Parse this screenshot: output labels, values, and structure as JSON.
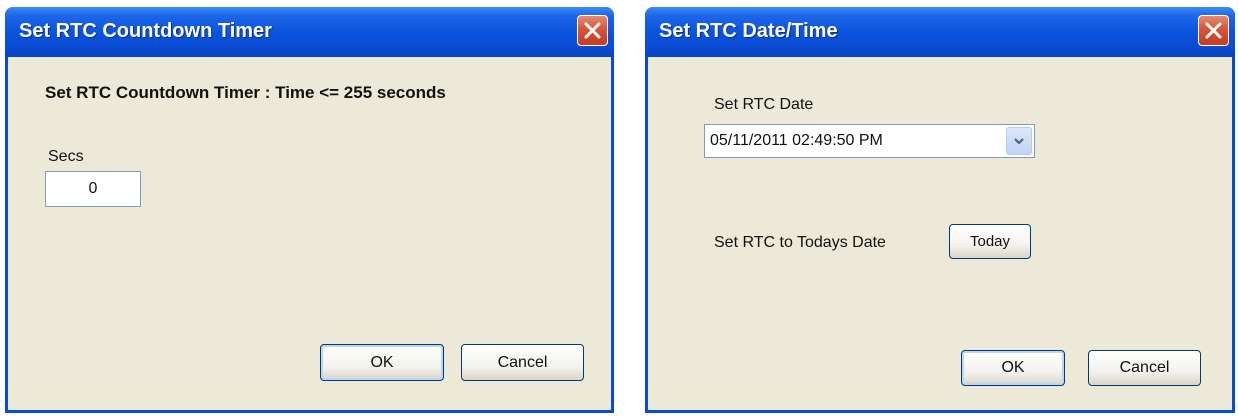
{
  "countdown_dialog": {
    "title": "Set RTC Countdown Timer",
    "heading": "Set RTC Countdown Timer : Time <= 255 seconds",
    "secs_label": "Secs",
    "secs_value": "0",
    "ok_label": "OK",
    "cancel_label": "Cancel"
  },
  "datetime_dialog": {
    "title": "Set RTC Date/Time",
    "date_label": "Set RTC Date",
    "date_value": "05/11/2011 02:49:50 PM",
    "today_label": "Set RTC to Todays Date",
    "today_button": "Today",
    "ok_label": "OK",
    "cancel_label": "Cancel"
  },
  "icons": {
    "close": "close-icon",
    "dropdown": "chevron-down-icon"
  },
  "colors": {
    "titlebar": "#0a52dc",
    "window_bg": "#ece9d8",
    "close_button": "#d6553a"
  }
}
